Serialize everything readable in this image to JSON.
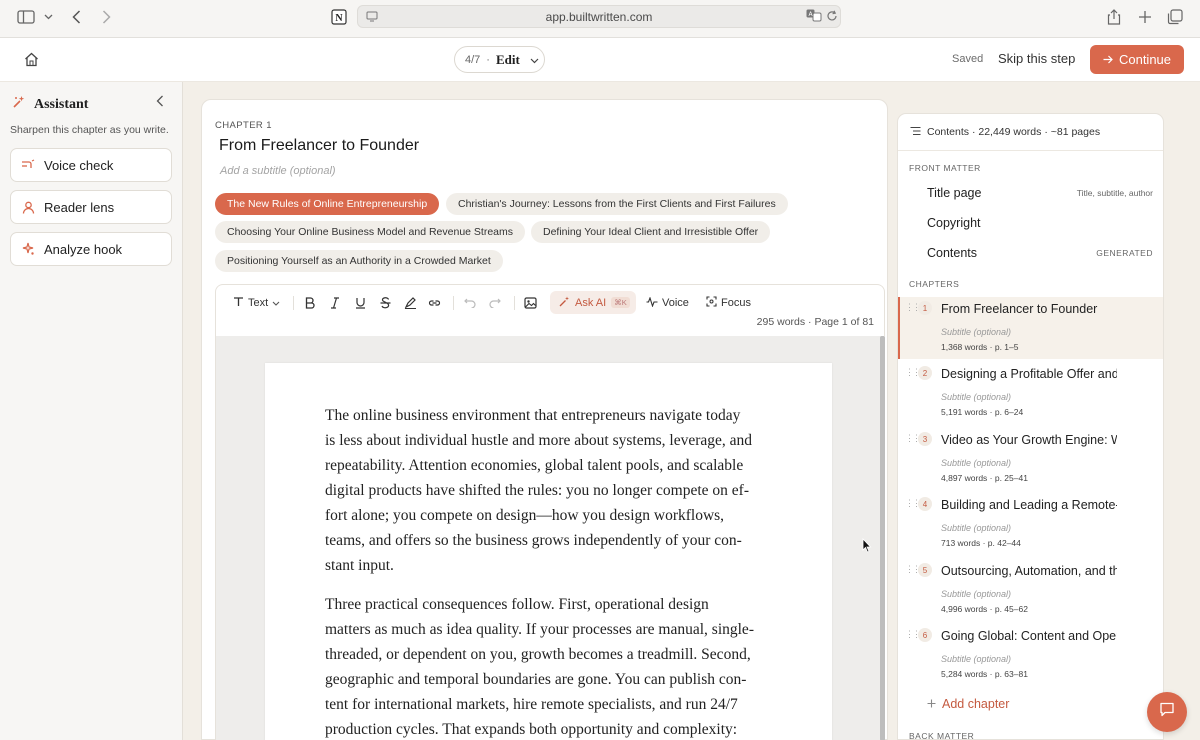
{
  "browser": {
    "url": "app.builtwritten.com",
    "icons": [
      "sidebar-icon",
      "chevron-down-icon",
      "back-icon",
      "forward-icon",
      "notion-icon",
      "site-settings-icon",
      "translate-icon",
      "reload-icon",
      "share-icon",
      "new-tab-icon",
      "tabs-icon"
    ]
  },
  "header": {
    "step_count": "4/7",
    "step_sep": "·",
    "mode": "Edit",
    "saved": "Saved",
    "skip": "Skip this step",
    "continue_label": "Continue",
    "accent": "#d9684c"
  },
  "assistant": {
    "title": "Assistant",
    "subtitle": "Sharpen this chapter as you write.",
    "tools": [
      {
        "label": "Voice check",
        "icon": "voice-icon"
      },
      {
        "label": "Reader lens",
        "icon": "user-icon"
      },
      {
        "label": "Analyze hook",
        "icon": "sparkle-icon"
      }
    ]
  },
  "chapter": {
    "eyebrow": "CHAPTER 1",
    "title": "From Freelancer to Founder",
    "subtitle_placeholder": "Add a subtitle (optional)",
    "sections": [
      "The New Rules of Online Entrepreneurship",
      "Christian's Journey: Lessons from the First Clients and First Failures",
      "Choosing Your Online Business Model and Revenue Streams",
      "Defining Your Ideal Client and Irresistible Offer",
      "Positioning Yourself as an Authority in a Crowded Market"
    ],
    "active_section": 0
  },
  "editor": {
    "text_style": "Text",
    "ask_ai": "Ask AI",
    "ask_ai_shortcut": "⌘K",
    "voice": "Voice",
    "focus": "Focus",
    "status": "295 words · Page 1 of 81",
    "paragraphs": [
      "The online business environment that entrepreneurs navigate today\nis less about individual hustle and more about systems, leverage, and\nrepeatability. Attention economies, global talent pools, and scalable\ndigital products have shifted the rules: you no longer compete on ef-\nfort alone; you compete on design—how you design workflows,\nteams, and offers so the business grows independently of your con-\nstant input.",
      "     Three practical consequences follow. First, operational design\nmatters as much as idea quality. If your processes are manual, single-\nthreaded, or dependent on you, growth becomes a treadmill. Second,\ngeographic and temporal boundaries are gone. You can publish con-\ntent for international markets, hire remote specialists, and run 24/7\nproduction cycles. That expands both opportunity and complexity:"
    ]
  },
  "contents": {
    "summary": "Contents · 22,449 words · ~81 pages",
    "front_matter_label": "FRONT MATTER",
    "front_matter": [
      {
        "label": "Title page",
        "meta": "Title, subtitle, author"
      },
      {
        "label": "Copyright",
        "meta": ""
      },
      {
        "label": "Contents",
        "meta": "GENERATED"
      }
    ],
    "chapters_label": "CHAPTERS",
    "chapters": [
      {
        "num": "1",
        "title": "From Freelancer to Founder",
        "subtitle": "Subtitle (optional)",
        "meta": "1,368 words · p. 1–5"
      },
      {
        "num": "2",
        "title": "Designing a Profitable Offer and",
        "subtitle": "Subtitle (optional)",
        "meta": "5,191 words · p. 6–24"
      },
      {
        "num": "3",
        "title": "Video as Your Growth Engine: W",
        "subtitle": "Subtitle (optional)",
        "meta": "4,897 words · p. 25–41"
      },
      {
        "num": "4",
        "title": "Building and Leading a Remote-",
        "subtitle": "Subtitle (optional)",
        "meta": "713 words · p. 42–44"
      },
      {
        "num": "5",
        "title": "Outsourcing, Automation, and th",
        "subtitle": "Subtitle (optional)",
        "meta": "4,996 words · p. 45–62"
      },
      {
        "num": "6",
        "title": "Going Global: Content and Oper",
        "subtitle": "Subtitle (optional)",
        "meta": "5,284 words · p. 63–81"
      }
    ],
    "add_chapter": "Add chapter",
    "back_matter_label": "BACK MATTER"
  }
}
